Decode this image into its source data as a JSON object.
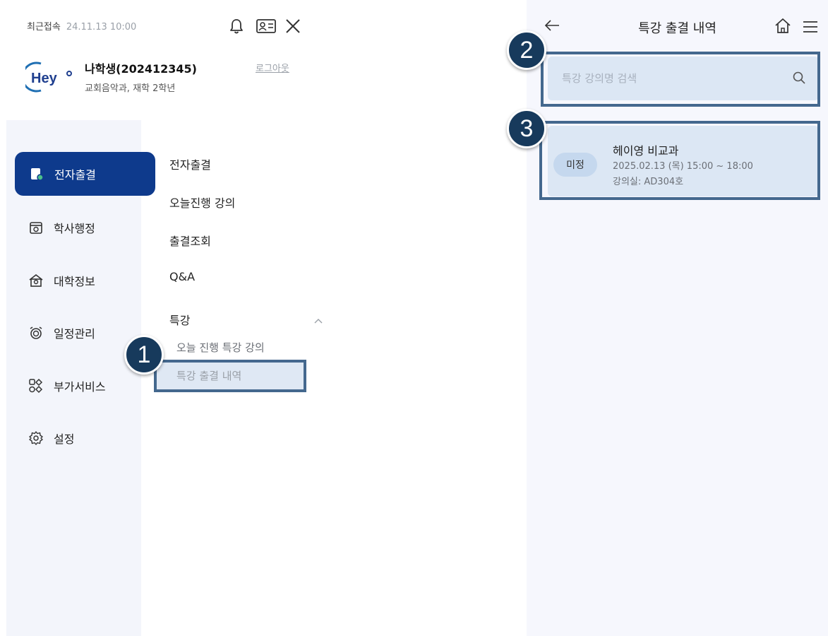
{
  "header": {
    "recent_label": "최근접속",
    "recent_time": "24.11.13 10:00",
    "icons": [
      "bell-icon",
      "id-card-icon",
      "close-icon"
    ]
  },
  "profile": {
    "logo_text": "Hey",
    "name": "나학생(202412345)",
    "department": "교회음악과, 재학 2학년",
    "logout_label": "로그아웃"
  },
  "sidebar": {
    "items": [
      {
        "label": "전자출결",
        "icon": "attendance-icon",
        "active": true
      },
      {
        "label": "학사행정",
        "icon": "academic-icon",
        "active": false
      },
      {
        "label": "대학정보",
        "icon": "university-icon",
        "active": false
      },
      {
        "label": "일정관리",
        "icon": "alarm-clock-icon",
        "active": false
      },
      {
        "label": "부가서비스",
        "icon": "services-icon",
        "active": false
      },
      {
        "label": "설정",
        "icon": "gear-icon",
        "active": false
      }
    ]
  },
  "submenu": {
    "items": [
      {
        "label": "전자출결"
      },
      {
        "label": "오늘진행 강의"
      },
      {
        "label": "출결조회"
      },
      {
        "label": "Q&A"
      },
      {
        "label": "특강"
      }
    ],
    "special_children": [
      {
        "label": "오늘 진행 특강 강의"
      },
      {
        "label": "특강 출결 내역"
      }
    ]
  },
  "right_panel": {
    "title": "특강 출결 내역",
    "search_placeholder": "특강 강의명 검색",
    "lectures": [
      {
        "status": "미정",
        "title": "헤이영 비교과",
        "datetime": "2025.02.13 (목) 15:00 ~ 18:00",
        "room": "강의실: AD304호"
      }
    ]
  },
  "annotations": {
    "badges": [
      "1",
      "2",
      "3"
    ],
    "highlight_color": "#44688e",
    "badge_color": "#173a5c"
  },
  "colors": {
    "primary": "#0e3a8c",
    "sidebar_bg": "#f3f5fb",
    "right_bg": "#f6f7fd",
    "card_bg": "#dce7f4",
    "logo_blue": "#1f6fb3"
  }
}
